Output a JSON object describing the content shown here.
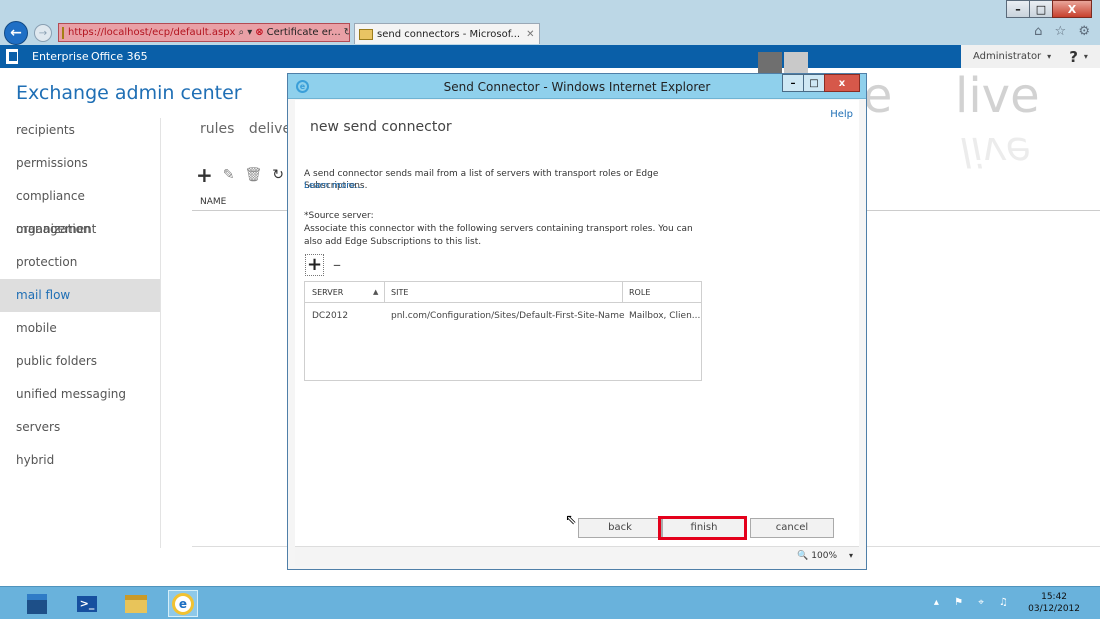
{
  "browser": {
    "address_url": "https://localhost/ecp/default.aspx",
    "address_search": "⌕ ▾",
    "address_cert": "Certificate er...",
    "address_refresh": "↻",
    "tab_label": "send connectors - Microsof...",
    "tab_close": "✕",
    "window_controls": {
      "minimize": "–",
      "restore": "□",
      "close": "X"
    },
    "right_icons": "⌂ ☆ ⚙"
  },
  "suitebar": {
    "enterprise": "Enterprise",
    "office365": "Office 365",
    "user": "Administrator",
    "caret": "▾",
    "help": "?"
  },
  "eac": {
    "title": "Exchange admin center",
    "nav": [
      "recipients",
      "permissions",
      "compliance management",
      "organization",
      "protection",
      "mail flow",
      "mobile",
      "public folders",
      "unified messaging",
      "servers",
      "hybrid"
    ],
    "active_nav": "mail flow",
    "subtabs": [
      "rules",
      "delivery"
    ],
    "toolbar": {
      "add": "+",
      "edit": "✎",
      "delete": "🗑",
      "refresh": "↻"
    },
    "column_name": "NAME"
  },
  "watermark": {
    "left": "pete",
    "right": "live"
  },
  "dialog": {
    "window_title": "Send Connector - Windows Internet Explorer",
    "controls": {
      "minimize": "–",
      "restore": "□",
      "close": "x"
    },
    "heading": "new send connector",
    "help_link": "Help",
    "description": "A send connector sends mail from a list of servers with transport roles or Edge Subscriptions.",
    "learn_more": "Learn more...",
    "source_label": "*Source server:",
    "source_desc": "Associate this connector with the following servers containing transport roles. You can also add Edge Subscriptions to this list.",
    "add_symbol": "+",
    "remove_symbol": "–",
    "table": {
      "headers": [
        "SERVER",
        "SITE",
        "ROLE"
      ],
      "sort_indicator": "▲",
      "rows": [
        [
          "DC2012",
          "pnl.com/Configuration/Sites/Default-First-Site-Name",
          "Mailbox, Clien..."
        ]
      ]
    },
    "buttons": {
      "back": "back",
      "finish": "finish",
      "cancel": "cancel"
    },
    "zoom": "🔍 100%",
    "zoom_caret": "▾",
    "cursor": "⇖"
  },
  "taskbar": {
    "powershell": ">_",
    "tray": "▴ ⚑ ⌖ ♫",
    "time": "15:42",
    "date": "03/12/2012"
  },
  "colors": {
    "accent_blue": "#1f6fb5",
    "suitebar_blue": "#0a5fa8",
    "highlight_red": "#e4001b",
    "dialog_titlebar": "#8fd0ec",
    "taskbar": "#69b2dc"
  }
}
